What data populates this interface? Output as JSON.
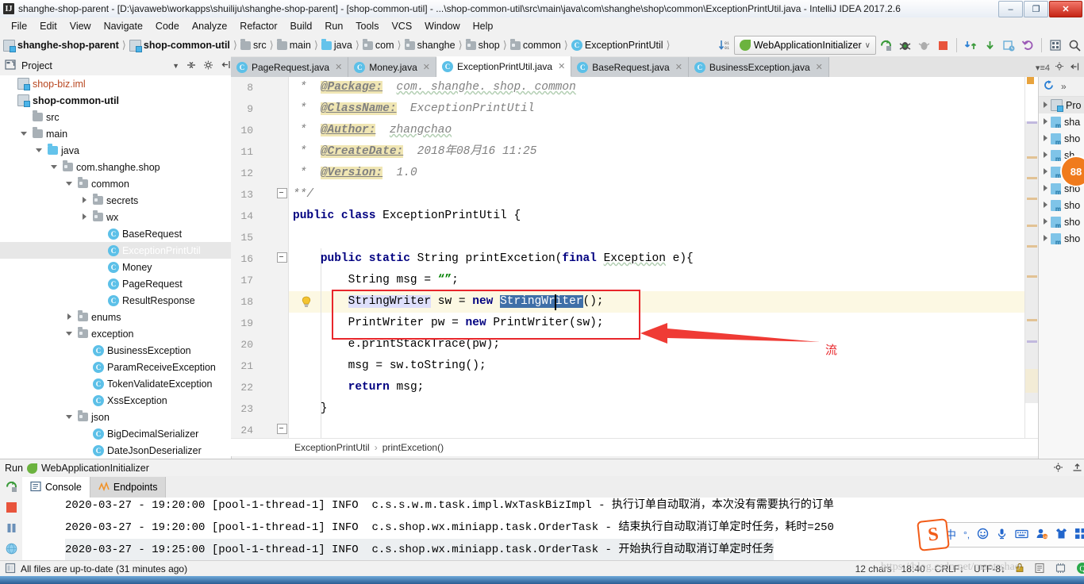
{
  "window": {
    "title": "shanghe-shop-parent - [D:\\javaweb\\workapps\\shuiliju\\shanghe-shop-parent] - [shop-common-util] - ...\\shop-common-util\\src\\main\\java\\com\\shanghe\\shop\\common\\ExceptionPrintUtil.java - IntelliJ IDEA 2017.2.6",
    "minimize": "–",
    "maximize": "❐",
    "close": "✕"
  },
  "menubar": [
    "File",
    "Edit",
    "View",
    "Navigate",
    "Code",
    "Analyze",
    "Refactor",
    "Build",
    "Run",
    "Tools",
    "VCS",
    "Window",
    "Help"
  ],
  "breadcrumb": [
    {
      "label": "shanghe-shop-parent",
      "icon": "module-icon",
      "bold": true
    },
    {
      "label": "shop-common-util",
      "icon": "module-icon",
      "bold": true
    },
    {
      "label": "src",
      "icon": "folder-icon",
      "bold": false
    },
    {
      "label": "main",
      "icon": "folder-icon",
      "bold": false
    },
    {
      "label": "java",
      "icon": "source-folder-icon",
      "bold": false
    },
    {
      "label": "com",
      "icon": "package-icon",
      "bold": false
    },
    {
      "label": "shanghe",
      "icon": "package-icon",
      "bold": false
    },
    {
      "label": "shop",
      "icon": "package-icon",
      "bold": false
    },
    {
      "label": "common",
      "icon": "package-icon",
      "bold": false
    },
    {
      "label": "ExceptionPrintUtil",
      "icon": "class-icon",
      "bold": false
    }
  ],
  "toolbar": {
    "run_config": "WebApplicationInitializer",
    "dropdown_caret": "∨",
    "icons": [
      "sort-icon",
      "run-icon",
      "debug-icon",
      "coverage-icon",
      "stop-icon",
      "update-project-icon",
      "commit-icon",
      "history-icon",
      "revert-icon",
      "structure-icon",
      "search-icon"
    ]
  },
  "project_panel": {
    "title": "Project",
    "tree": [
      {
        "label": "shop-biz.iml",
        "depth": 0,
        "icon": "iml-icon",
        "toggle": "none",
        "style": "iml"
      },
      {
        "label": "shop-common-util",
        "depth": 0,
        "icon": "module-icon",
        "toggle": "none",
        "style": "bold"
      },
      {
        "label": "src",
        "depth": 1,
        "icon": "folder-icon",
        "toggle": "none",
        "style": ""
      },
      {
        "label": "main",
        "depth": 1,
        "icon": "folder-icon",
        "toggle": "down",
        "style": ""
      },
      {
        "label": "java",
        "depth": 2,
        "icon": "source-folder-icon",
        "toggle": "down",
        "style": ""
      },
      {
        "label": "com.shanghe.shop",
        "depth": 3,
        "icon": "package-icon",
        "toggle": "down",
        "style": ""
      },
      {
        "label": "common",
        "depth": 4,
        "icon": "package-icon",
        "toggle": "down",
        "style": ""
      },
      {
        "label": "secrets",
        "depth": 5,
        "icon": "package-icon",
        "toggle": "right",
        "style": ""
      },
      {
        "label": "wx",
        "depth": 5,
        "icon": "package-icon",
        "toggle": "right",
        "style": ""
      },
      {
        "label": "BaseRequest",
        "depth": 6,
        "icon": "class-icon",
        "toggle": "none",
        "style": ""
      },
      {
        "label": "ExceptionPrintUtil",
        "depth": 6,
        "icon": "class-icon",
        "toggle": "none",
        "style": "selected"
      },
      {
        "label": "Money",
        "depth": 6,
        "icon": "class-icon",
        "toggle": "none",
        "style": ""
      },
      {
        "label": "PageRequest",
        "depth": 6,
        "icon": "class-icon",
        "toggle": "none",
        "style": ""
      },
      {
        "label": "ResultResponse",
        "depth": 6,
        "icon": "class-icon",
        "toggle": "none",
        "style": ""
      },
      {
        "label": "enums",
        "depth": 4,
        "icon": "package-icon",
        "toggle": "right",
        "style": ""
      },
      {
        "label": "exception",
        "depth": 4,
        "icon": "package-icon",
        "toggle": "down",
        "style": ""
      },
      {
        "label": "BusinessException",
        "depth": 5,
        "icon": "class-icon",
        "toggle": "none",
        "style": ""
      },
      {
        "label": "ParamReceiveException",
        "depth": 5,
        "icon": "class-icon",
        "toggle": "none",
        "style": ""
      },
      {
        "label": "TokenValidateException",
        "depth": 5,
        "icon": "class-icon",
        "toggle": "none",
        "style": ""
      },
      {
        "label": "XssException",
        "depth": 5,
        "icon": "class-icon",
        "toggle": "none",
        "style": ""
      },
      {
        "label": "json",
        "depth": 4,
        "icon": "package-icon",
        "toggle": "down",
        "style": ""
      },
      {
        "label": "BigDecimalSerializer",
        "depth": 5,
        "icon": "class-icon",
        "toggle": "none",
        "style": ""
      },
      {
        "label": "DateJsonDeserializer",
        "depth": 5,
        "icon": "class-icon",
        "toggle": "none",
        "style": ""
      }
    ]
  },
  "editor_tabs": [
    {
      "label": "PageRequest.java",
      "active": false,
      "close": "✕"
    },
    {
      "label": "Money.java",
      "active": false,
      "close": "✕"
    },
    {
      "label": "ExceptionPrintUtil.java",
      "active": true,
      "close": "✕"
    },
    {
      "label": "BaseRequest.java",
      "active": false,
      "close": "✕"
    },
    {
      "label": "BusinessException.java",
      "active": false,
      "close": "✕"
    }
  ],
  "editor_tabs_right": {
    "count": "4"
  },
  "code": {
    "lines": [
      {
        "n": "8",
        "text": " *  @Package:  com. shanghe. shop. common"
      },
      {
        "n": "9",
        "text": " *  @ClassName:  ExceptionPrintUtil"
      },
      {
        "n": "10",
        "text": " *  @Author:  zhangchao"
      },
      {
        "n": "11",
        "text": " *  @CreateDate:  2018年08月16 11:25"
      },
      {
        "n": "12",
        "text": " *  @Version:  1.0"
      },
      {
        "n": "13",
        "text": "**/"
      },
      {
        "n": "14",
        "text": "public class ExceptionPrintUtil {"
      },
      {
        "n": "15",
        "text": ""
      },
      {
        "n": "16",
        "text": "    public static String printExcetion(final Exception e){"
      },
      {
        "n": "17",
        "text": "        String msg = “”;"
      },
      {
        "n": "18",
        "text": "        StringWriter sw = new StringWriter();"
      },
      {
        "n": "19",
        "text": "        PrintWriter pw = new PrintWriter(sw);"
      },
      {
        "n": "20",
        "text": "        e.printStackTrace(pw);"
      },
      {
        "n": "21",
        "text": "        msg = sw.toString();"
      },
      {
        "n": "22",
        "text": "        return msg;"
      },
      {
        "n": "23",
        "text": "    }"
      },
      {
        "n": "24",
        "text": ""
      }
    ]
  },
  "editor_breadcrumb": {
    "class": "ExceptionPrintUtil",
    "sep": "›",
    "method": "printExcetion()"
  },
  "annotation": {
    "label": "流"
  },
  "maven_panel": {
    "title": "Pro",
    "rows": [
      "sha",
      "sho",
      "sh",
      "sho",
      "sho",
      "sho",
      "sho",
      "sho"
    ],
    "badge": "88"
  },
  "run_panel": {
    "title": "Run",
    "config": "WebApplicationInitializer",
    "tabs": [
      {
        "label": "Console",
        "active": true,
        "icon": "console-icon"
      },
      {
        "label": "Endpoints",
        "active": false,
        "icon": "endpoints-icon"
      }
    ],
    "console_lines": [
      "2020-03-27 - 19:20:00 [pool-1-thread-1] INFO  c.s.s.w.m.task.impl.WxTaskBizImpl - 执行订单自动取消，本次没有需要执行的订单",
      "2020-03-27 - 19:20:00 [pool-1-thread-1] INFO  c.s.shop.wx.miniapp.task.OrderTask - 结束执行自动取消订单定时任务，耗时=250",
      "2020-03-27 - 19:25:00 [pool-1-thread-1] INFO  c.s.shop.wx.miniapp.task.OrderTask - 开始执行自动取消订单定时任务"
    ]
  },
  "status_bar": {
    "message": "All files are up-to-date (31 minutes ago)",
    "chars": "12 chars",
    "position": "18:40",
    "line_sep": "CRLF↕",
    "encoding": "UTF-8↕",
    "lock": "lock-icon"
  },
  "watermark": "https://blog.csdn.net/maotrshao",
  "ime": {
    "logo": "S",
    "mode": "中",
    "punct": "°,",
    "icons": [
      "smiley-icon",
      "microphone-icon",
      "keyboard-icon",
      "user-icon",
      "skin-icon",
      "apps-icon"
    ]
  }
}
